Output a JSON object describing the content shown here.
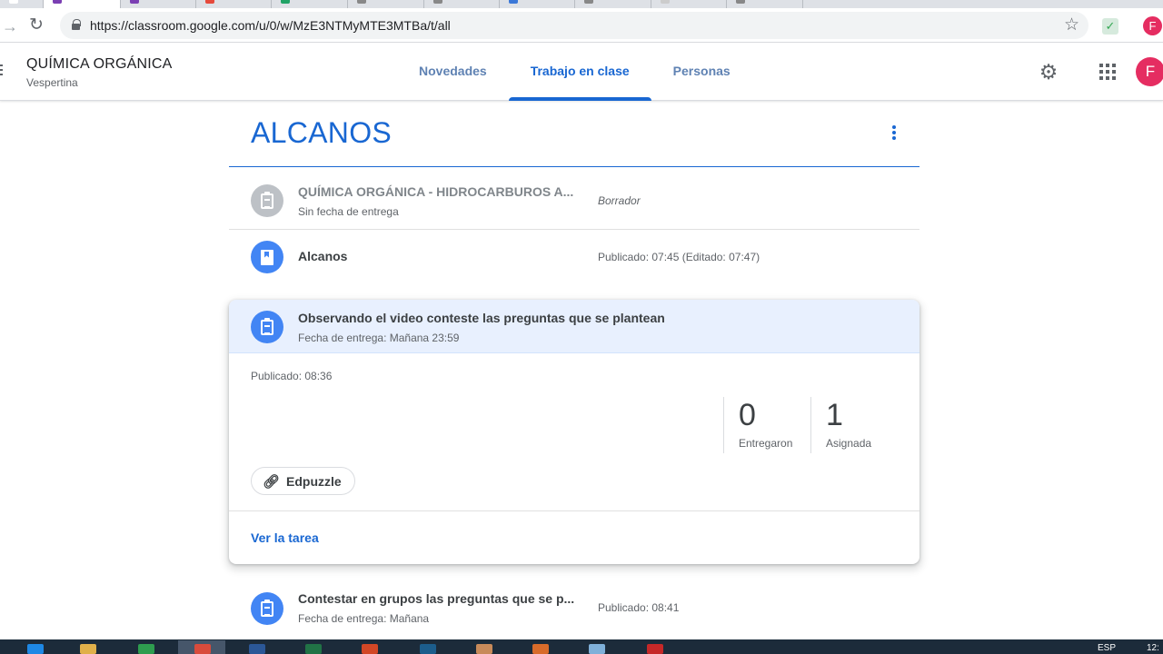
{
  "browser": {
    "url": "https://classroom.google.com/u/0/w/MzE3NTMyMTE3MTBa/t/all",
    "profile_initial": "F",
    "tab_colors": [
      "#ffffff",
      "#7b3fb3",
      "#7b3fb3",
      "#e64a3c",
      "#21a366",
      "#888888",
      "#888888",
      "#3b78d8",
      "#888888",
      "#cccccc",
      "#888888"
    ]
  },
  "header": {
    "class_name": "QUÍMICA ORGÁNICA",
    "section": "Vespertina",
    "tabs": [
      {
        "label": "Novedades",
        "active": false
      },
      {
        "label": "Trabajo en clase",
        "active": true
      },
      {
        "label": "Personas",
        "active": false
      }
    ],
    "avatar_initial": "F",
    "icons": {
      "settings": "gear-icon",
      "apps": "apps-grid-icon"
    }
  },
  "topic": {
    "title": "ALCANOS"
  },
  "items": [
    {
      "title": "QUÍMICA ORGÁNICA - HIDROCARBUROS A...",
      "subtitle": "Sin fecha de entrega",
      "status": "Borrador",
      "icon": "assignment-icon",
      "draft": true
    },
    {
      "title": "Alcanos",
      "subtitle": "",
      "status": "Publicado: 07:45 (Editado: 07:47)",
      "icon": "material-icon",
      "draft": false
    }
  ],
  "expanded": {
    "title": "Observando el video conteste las preguntas que se plantean",
    "due": "Fecha de entrega: Mañana 23:59",
    "published": "Publicado: 08:36",
    "stats": [
      {
        "value": "0",
        "label": "Entregaron"
      },
      {
        "value": "1",
        "label": "Asignada"
      }
    ],
    "attachment": "Edpuzzle",
    "view_link": "Ver la tarea"
  },
  "last_item": {
    "title": "Contestar en grupos las preguntas que se p...",
    "subtitle": "Fecha de entrega: Mañana",
    "status": "Publicado: 08:41"
  },
  "taskbar": {
    "lang": "ESP",
    "clock": "12:",
    "app_colors": [
      "#1e88e5",
      "#e0b04a",
      "#2e9d4f",
      "#d94b3c",
      "#2b5797",
      "#217346",
      "#d24726",
      "#1c5d8c",
      "#c88a5a",
      "#d86b2a",
      "#7fb0d9",
      "#c62828"
    ]
  },
  "colors": {
    "accent": "#1967d2",
    "assignment_icon": "#4285f4",
    "avatar": "#e52d61"
  }
}
